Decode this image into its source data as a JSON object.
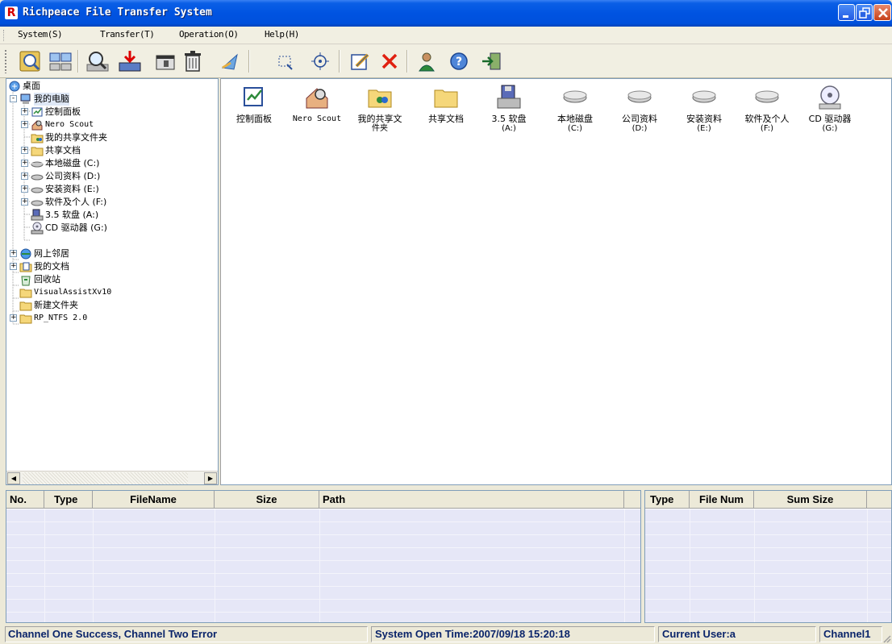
{
  "window": {
    "title": "Richpeace File Transfer System",
    "logo_letter": "R"
  },
  "menu": [
    {
      "label": "System(S)"
    },
    {
      "label": "Transfer(T)"
    },
    {
      "label": "Operation(O)"
    },
    {
      "label": "Help(H)"
    }
  ],
  "toolbar": [
    {
      "icon": "magnifier-disk-icon"
    },
    {
      "icon": "computers-network-icon"
    },
    {
      "icon": "find-icon"
    },
    {
      "icon": "download-icon"
    },
    {
      "icon": "folder-view-icon"
    },
    {
      "icon": "trash-icon"
    },
    {
      "icon": "send-icon"
    },
    {
      "icon": "select-rect-icon"
    },
    {
      "icon": "target-icon"
    },
    {
      "icon": "edit-icon"
    },
    {
      "icon": "delete-icon"
    },
    {
      "icon": "user-icon"
    },
    {
      "icon": "help-icon"
    },
    {
      "icon": "exit-icon"
    }
  ],
  "tree": [
    {
      "label": "桌面",
      "icon": "desktop-icon",
      "expander": ""
    },
    {
      "label": "我的电脑",
      "icon": "my-computer-icon",
      "expander": "-",
      "selected": true
    },
    {
      "label": "控制面板",
      "icon": "control-panel-icon",
      "expander": "+"
    },
    {
      "label": "Nero Scout",
      "icon": "nero-scout-icon",
      "expander": "+"
    },
    {
      "label": "我的共享文件夹",
      "icon": "shared-folder-icon",
      "expander": ""
    },
    {
      "label": "共享文档",
      "icon": "folder-icon",
      "expander": "+"
    },
    {
      "label": "本地磁盘 (C:)",
      "icon": "hard-disk-icon",
      "expander": "+"
    },
    {
      "label": "公司资料 (D:)",
      "icon": "hard-disk-icon",
      "expander": "+"
    },
    {
      "label": "安装资料 (E:)",
      "icon": "hard-disk-icon",
      "expander": "+"
    },
    {
      "label": "软件及个人 (F:)",
      "icon": "hard-disk-icon",
      "expander": "+"
    },
    {
      "label": "3.5 软盘 (A:)",
      "icon": "floppy-drive-icon",
      "expander": ""
    },
    {
      "label": "CD 驱动器 (G:)",
      "icon": "cd-drive-icon",
      "expander": ""
    },
    {
      "label": "网上邻居",
      "icon": "network-places-icon",
      "expander": "+"
    },
    {
      "label": "我的文档",
      "icon": "my-documents-icon",
      "expander": "+"
    },
    {
      "label": "回收站",
      "icon": "recycle-bin-icon",
      "expander": ""
    },
    {
      "label": "VisualAssistXv10",
      "icon": "folder-icon",
      "expander": ""
    },
    {
      "label": "新建文件夹",
      "icon": "folder-icon",
      "expander": ""
    },
    {
      "label": "RP_NTFS 2.0",
      "icon": "folder-icon",
      "expander": "+"
    }
  ],
  "icons": [
    {
      "label": "控制面板",
      "label2": "",
      "icon": "control-panel-icon"
    },
    {
      "label": "Nero Scout",
      "label2": "",
      "icon": "nero-scout-icon"
    },
    {
      "label": "我的共享文",
      "label2": "件夹",
      "icon": "shared-folder-icon"
    },
    {
      "label": "共享文档",
      "label2": "",
      "icon": "folder-icon"
    },
    {
      "label": "3.5 软盘",
      "label2": "(A:)",
      "icon": "floppy-drive-icon"
    },
    {
      "label": "本地磁盘",
      "label2": "(C:)",
      "icon": "hard-disk-icon"
    },
    {
      "label": "公司资料",
      "label2": "(D:)",
      "icon": "hard-disk-icon"
    },
    {
      "label": "安装资料",
      "label2": "(E:)",
      "icon": "hard-disk-icon"
    },
    {
      "label": "软件及个人",
      "label2": "(F:)",
      "icon": "hard-disk-icon"
    },
    {
      "label": "CD 驱动器",
      "label2": "(G:)",
      "icon": "cd-drive-icon"
    }
  ],
  "transfer_table": {
    "columns": [
      "No.",
      "Type",
      "FileName",
      "Size",
      "Path",
      ""
    ],
    "rows": []
  },
  "summary_table": {
    "columns": [
      "Type",
      "File Num",
      "Sum Size",
      ""
    ],
    "rows": []
  },
  "status": {
    "channel_status": "Channel One Success, Channel Two Error",
    "open_time": "System Open Time:2007/09/18  15:20:18",
    "current_user": "Current User:a",
    "channel": "Channel1"
  }
}
